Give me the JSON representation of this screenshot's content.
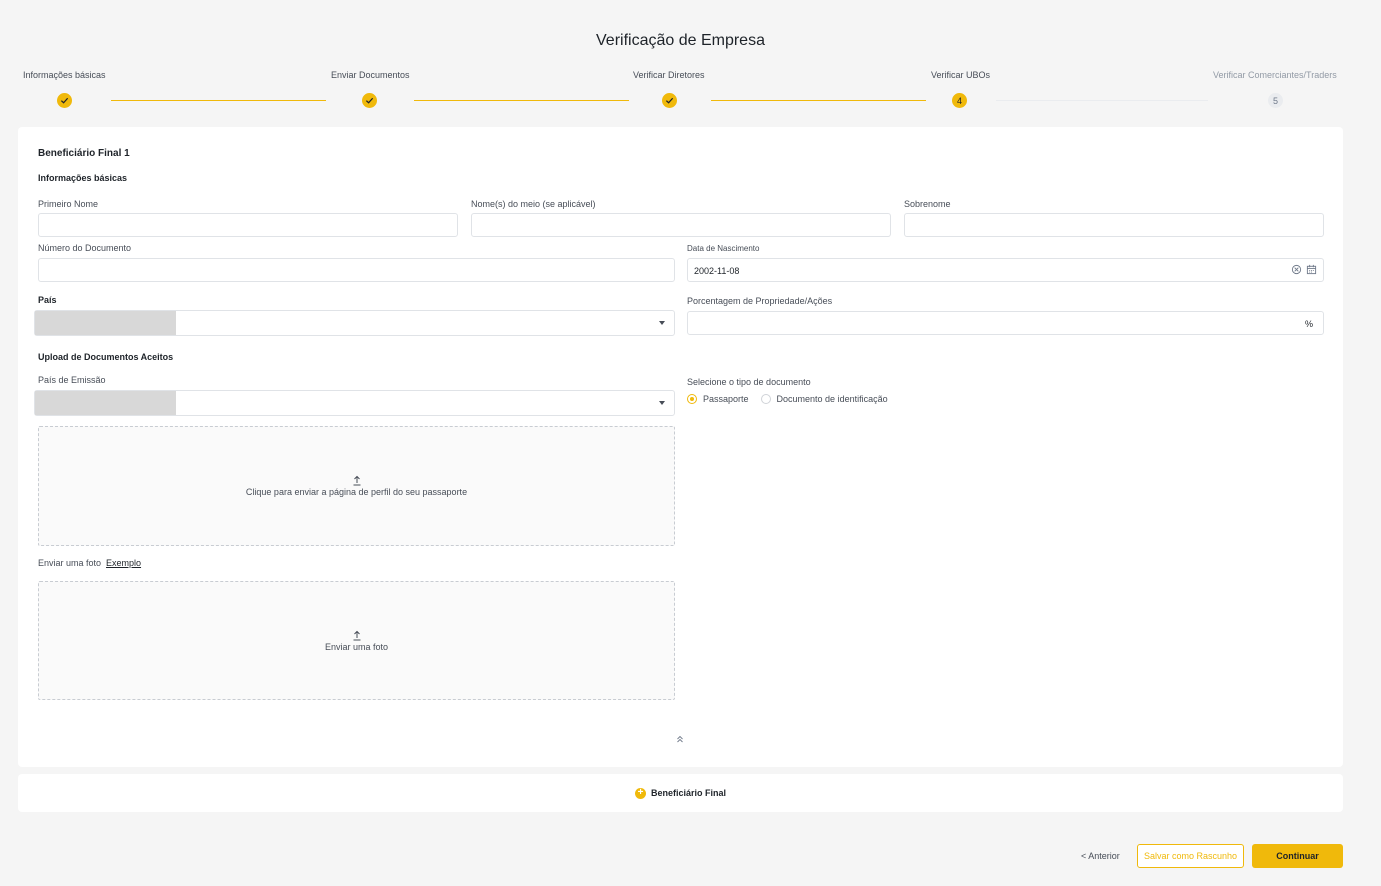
{
  "page": {
    "title": "Verificação de Empresa"
  },
  "stepper": {
    "steps": [
      {
        "label": "Informações básicas",
        "state": "done"
      },
      {
        "label": "Enviar Documentos",
        "state": "done"
      },
      {
        "label": "Verificar Diretores",
        "state": "done"
      },
      {
        "label": "Verificar UBOs",
        "state": "current",
        "number": "4"
      },
      {
        "label": "Verificar Comerciantes/Traders",
        "state": "pending",
        "number": "5"
      }
    ]
  },
  "form": {
    "owner_title": "Beneficiário Final 1",
    "basic_info_heading": "Informações básicas",
    "first_name": {
      "label": "Primeiro Nome",
      "value": ""
    },
    "middle_name": {
      "label": "Nome(s) do meio (se aplicável)",
      "value": ""
    },
    "last_name": {
      "label": "Sobrenome",
      "value": ""
    },
    "document_number": {
      "label": "Número do Documento",
      "value": ""
    },
    "birth_date": {
      "label": "Data de Nascimento",
      "value": "2002-11-08"
    },
    "country": {
      "label": "País",
      "value": ""
    },
    "ownership": {
      "label": "Porcentagem de Propriedade/Ações",
      "value": "",
      "suffix": "%"
    },
    "upload_heading": "Upload de Documentos Aceitos",
    "issuing_country": {
      "label": "País de Emissão",
      "value": ""
    },
    "doc_type": {
      "label": "Selecione o tipo de documento",
      "options": [
        "Passaporte",
        "Documento de identificação"
      ],
      "selected": "Passaporte"
    },
    "passport_upload_text": "Clique para enviar a página de perfil do seu passaporte",
    "photo_label": "Enviar uma foto",
    "photo_example_link": "Exemplo",
    "photo_upload_text": "Enviar uma foto"
  },
  "add_owner": {
    "label": "Beneficiário Final"
  },
  "footer": {
    "back_label": "< Anterior",
    "save_draft_label": "Salvar como Rascunho",
    "continue_label": "Continuar"
  },
  "colors": {
    "accent": "#f0b90b",
    "text": "#1e2329",
    "muted": "#929aa5"
  },
  "icons": [
    "check-icon",
    "clear-icon",
    "calendar-icon",
    "chevron-down-icon",
    "upload-icon",
    "collapse-up-icon",
    "plus-icon"
  ]
}
